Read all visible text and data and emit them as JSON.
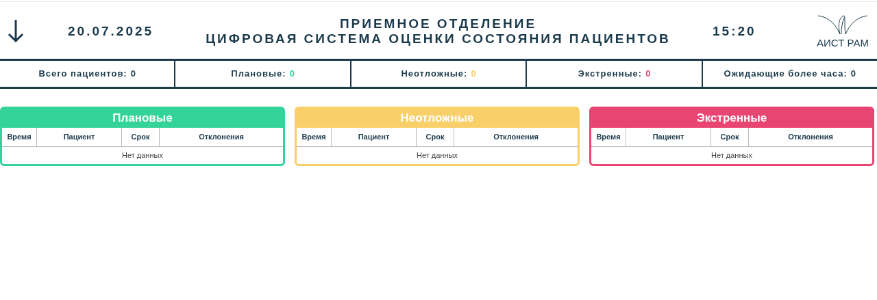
{
  "header": {
    "date": "20.07.2025",
    "title_line_1": "ПРИЕМНОЕ ОТДЕЛЕНИЕ",
    "title_line_2": "ЦИФРОВАЯ СИСТЕМА ОЦЕНКИ СОСТОЯНИЯ ПАЦИЕНТОВ",
    "time": "15:20",
    "logo_text": "АИСТ РАМ"
  },
  "stats": [
    {
      "label": "Всего пациентов:",
      "value": "0",
      "color": "#1b3a4b"
    },
    {
      "label": "Плановые:",
      "value": "0",
      "color": "#34d399"
    },
    {
      "label": "Неотложные:",
      "value": "0",
      "color": "#f9cf69"
    },
    {
      "label": "Экстренные:",
      "value": "0",
      "color": "#e94572"
    },
    {
      "label": "Ожидающие более часа:",
      "value": "0",
      "color": "#1b3a4b"
    }
  ],
  "panels": [
    {
      "title": "Плановые",
      "color": "#34d399",
      "columns": [
        "Время",
        "Пациент",
        "Срок",
        "Отклонения"
      ],
      "empty_text": "Нет данных"
    },
    {
      "title": "Неотложные",
      "color": "#f9cf69",
      "columns": [
        "Время",
        "Пациент",
        "Срок",
        "Отклонения"
      ],
      "empty_text": "Нет данных"
    },
    {
      "title": "Экстренные",
      "color": "#e94572",
      "columns": [
        "Время",
        "Пациент",
        "Срок",
        "Отклонения"
      ],
      "empty_text": "Нет данных"
    }
  ]
}
